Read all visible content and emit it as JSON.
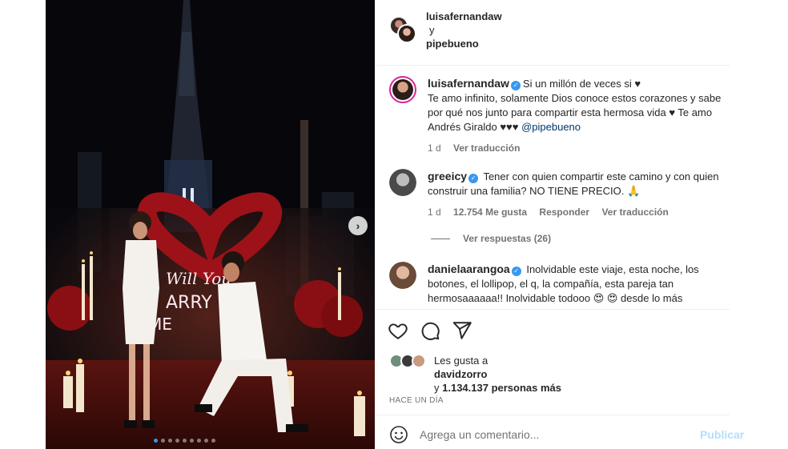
{
  "header": {
    "user1": "luisafernandaw",
    "conjunction": "y",
    "user2": "pipebueno"
  },
  "media": {
    "next_icon": "chevron-right-icon",
    "carousel_dots": 9,
    "active_dot": 0
  },
  "comments": [
    {
      "user": "luisafernandaw",
      "text_line1": "Si un millón de veces si ♥",
      "text_rest": "Te amo infinito, solamente Dios conoce estos corazones y sabe por qué nos junto para compartir esta hermosa vida ♥ Te amo Andrés Giraldo ♥♥♥ ",
      "mention": "@pipebueno",
      "age": "1 d",
      "translate": "Ver traducción"
    },
    {
      "user": "greeicy",
      "text": "Tener con quien compartir este camino y con quien construir una familia? NO TIENE PRECIO. 🙏",
      "age": "1 d",
      "likes": "12.754 Me gusta",
      "reply": "Responder",
      "translate": "Ver traducción",
      "view_replies": "Ver respuestas (26)"
    },
    {
      "user": "danielaarangoa",
      "text": "Inolvidable este viaje, esta noche, los botones, el lollipop, el q, la compañía, esta pareja tan hermosaaaaaa!! Inolvidable todooo 😍 😍  desde lo más"
    }
  ],
  "actions": {
    "like_icon": "heart-icon",
    "comment_icon": "comment-icon",
    "share_icon": "share-icon"
  },
  "likes": {
    "prefix": "Les gusta a",
    "user": "davidzorro",
    "and": "y",
    "count": "1.134.137 personas más"
  },
  "time": "HACE UN DÍA",
  "comment_bar": {
    "emoji_icon": "emoji-icon",
    "placeholder": "Agrega un comentario...",
    "publish": "Publicar"
  },
  "colors": {
    "link": "#00376b",
    "verified": "#3897f0",
    "muted": "#737373",
    "publish_disabled": "#b2dffc"
  }
}
